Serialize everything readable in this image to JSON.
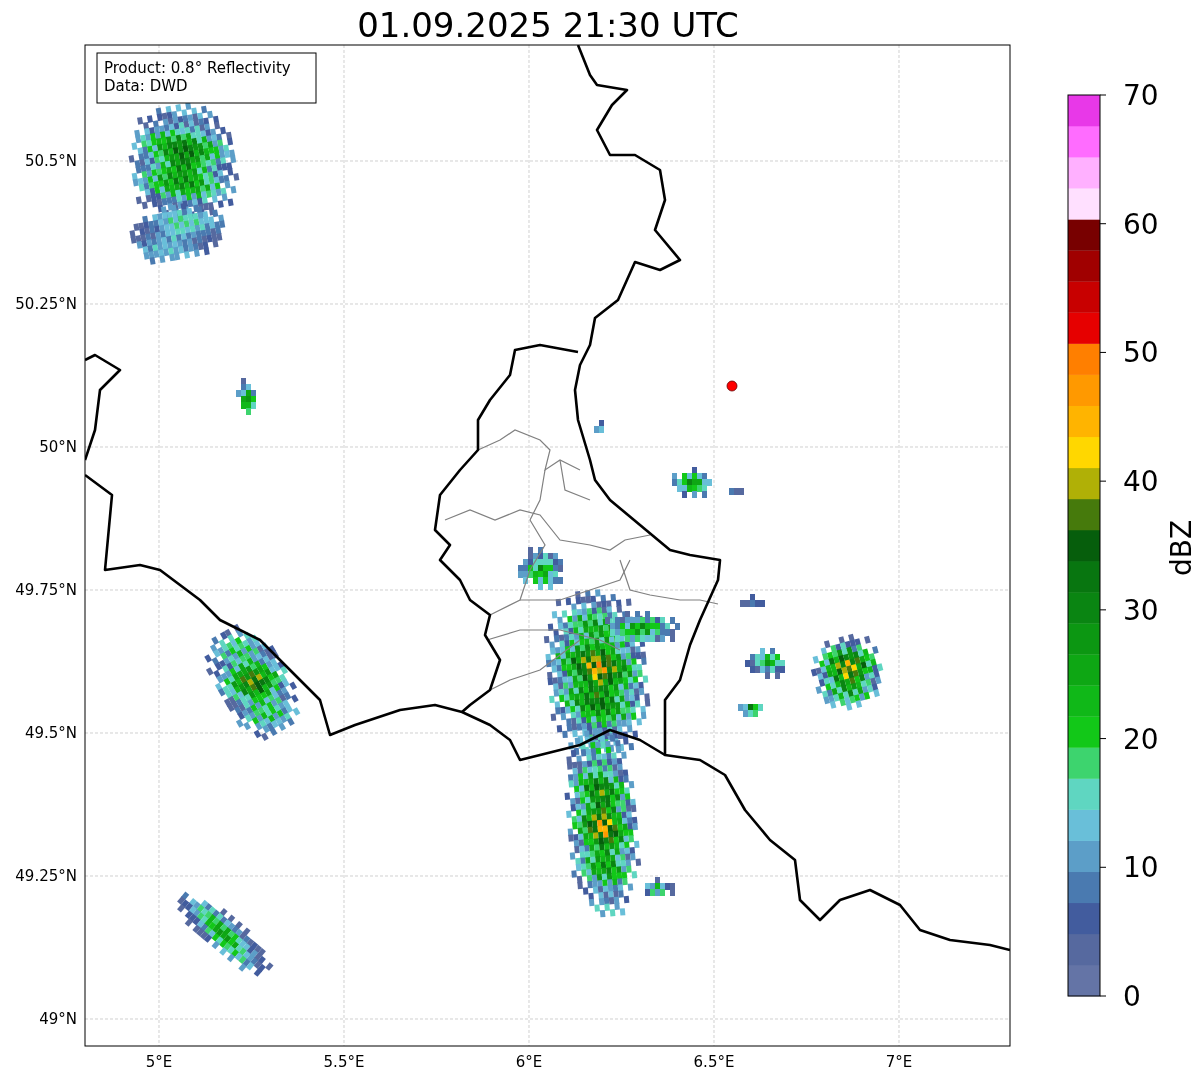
{
  "title": "01.09.2025 21:30 UTC",
  "info_box": {
    "lines": [
      "Product: 0.8° Reflectivity",
      "Data: DWD"
    ]
  },
  "map": {
    "lon_ticks": [
      "5°E",
      "5.5°E",
      "6°E",
      "6.5°E",
      "7°E"
    ],
    "lat_ticks": [
      "50.5°N",
      "50.25°N",
      "50°N",
      "49.75°N",
      "49.5°N",
      "49.25°N",
      "49°N"
    ]
  },
  "colorbar": {
    "label": "dBZ",
    "ticks": [
      "70",
      "60",
      "50",
      "40",
      "30",
      "20",
      "10",
      "0"
    ],
    "bands": [
      {
        "color": "#6474a6"
      },
      {
        "color": "#56699f"
      },
      {
        "color": "#425c9e"
      },
      {
        "color": "#4a7ab0"
      },
      {
        "color": "#5c9ec8"
      },
      {
        "color": "#69bfd9"
      },
      {
        "color": "#5fd6c1"
      },
      {
        "color": "#3dd46e"
      },
      {
        "color": "#12c818"
      },
      {
        "color": "#10b818"
      },
      {
        "color": "#0ea714"
      },
      {
        "color": "#0c9712"
      },
      {
        "color": "#0a8512"
      },
      {
        "color": "#087610"
      },
      {
        "color": "#065e0c"
      },
      {
        "color": "#467a0c"
      },
      {
        "color": "#b0b006"
      },
      {
        "color": "#ffd700"
      },
      {
        "color": "#ffb400"
      },
      {
        "color": "#ff9900"
      },
      {
        "color": "#ff7f00"
      },
      {
        "color": "#e60000"
      },
      {
        "color": "#c80000"
      },
      {
        "color": "#a00000"
      },
      {
        "color": "#780000"
      },
      {
        "color": "#ffe0ff"
      },
      {
        "color": "#ffb0ff"
      },
      {
        "color": "#ff6cff"
      },
      {
        "color": "#e838e8"
      }
    ]
  }
}
